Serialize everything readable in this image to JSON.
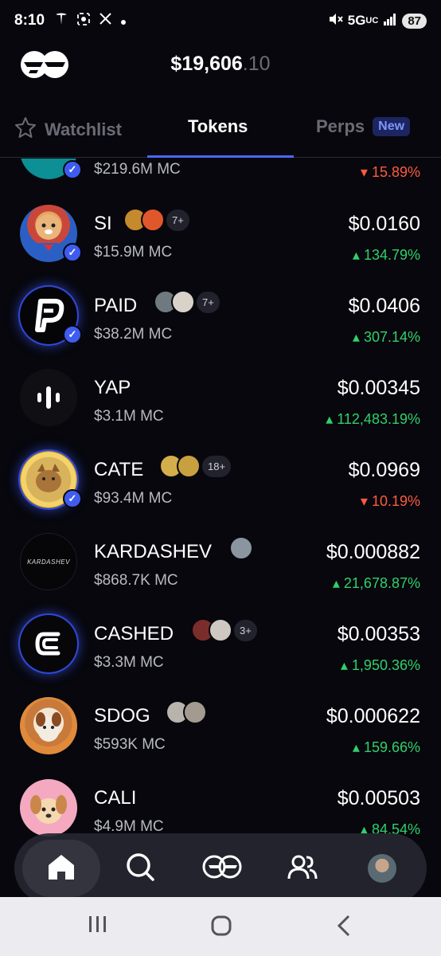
{
  "status": {
    "time": "8:10",
    "network": "5G",
    "network_sub": "UC",
    "battery": "87",
    "icons": [
      "tesla-icon",
      "screenshot-icon",
      "x-icon",
      "dot-icon",
      "mute-icon",
      "signal-icon"
    ]
  },
  "header": {
    "balance_main": "$19,606",
    "balance_cents": ".10"
  },
  "tabs": [
    {
      "label": "Watchlist",
      "active": false
    },
    {
      "label": "Tokens",
      "active": true
    },
    {
      "label": "Perps",
      "active": false,
      "badge": "New"
    }
  ],
  "tokens": [
    {
      "name": "",
      "mc": "$219.6M MC",
      "price": "",
      "change": "15.89%",
      "direction": "down",
      "verified": true
    },
    {
      "name": "SI",
      "mc": "$15.9M MC",
      "price": "$0.0160",
      "change": "134.79%",
      "direction": "up",
      "verified": true,
      "holders_count": "7+"
    },
    {
      "name": "PAID",
      "mc": "$38.2M MC",
      "price": "$0.0406",
      "change": "307.14%",
      "direction": "up",
      "verified": true,
      "holders_count": "7+"
    },
    {
      "name": "YAP",
      "mc": "$3.1M MC",
      "price": "$0.00345",
      "change": "112,483.19%",
      "direction": "up",
      "verified": false
    },
    {
      "name": "CATE",
      "mc": "$93.4M MC",
      "price": "$0.0969",
      "change": "10.19%",
      "direction": "down",
      "verified": true,
      "holders_count": "18+"
    },
    {
      "name": "KARDASHEV",
      "mc": "$868.7K MC",
      "price": "$0.000882",
      "change": "21,678.87%",
      "direction": "up",
      "verified": false,
      "logo_text": "KARDASHEV"
    },
    {
      "name": "CASHED",
      "mc": "$3.3M MC",
      "price": "$0.00353",
      "change": "1,950.36%",
      "direction": "up",
      "verified": false,
      "holders_count": "3+"
    },
    {
      "name": "SDOG",
      "mc": "$593K MC",
      "price": "$0.000622",
      "change": "159.66%",
      "direction": "up",
      "verified": false
    },
    {
      "name": "CALI",
      "mc": "$4.9M MC",
      "price": "$0.00503",
      "change": "84.54%",
      "direction": "up",
      "verified": false
    }
  ],
  "bottom_nav": [
    "home-icon",
    "search-icon",
    "logo-icon",
    "friends-icon",
    "profile-avatar"
  ],
  "colors": {
    "background": "#07070d",
    "accent": "#4a67ff",
    "up": "#2fd069",
    "down": "#ff5a3c"
  }
}
